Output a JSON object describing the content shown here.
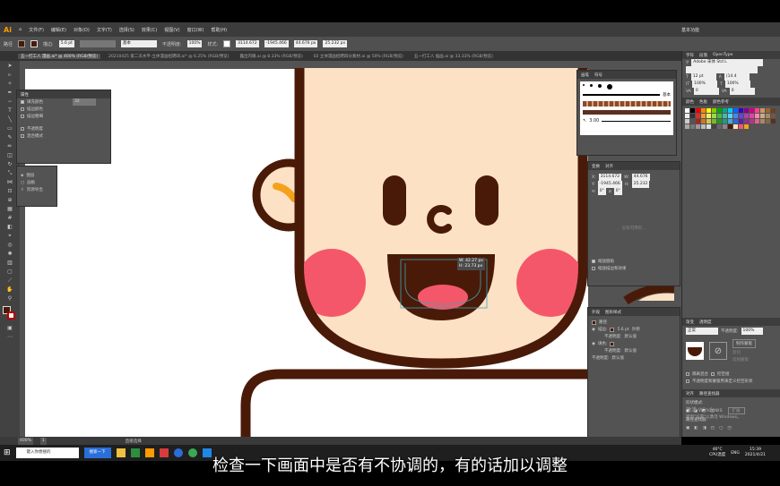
{
  "menubar": {
    "logo": "Ai",
    "items": [
      "文件(F)",
      "编辑(E)",
      "对象(O)",
      "文字(T)",
      "选择(S)",
      "效果(C)",
      "视图(V)",
      "窗口(W)",
      "帮助(H)"
    ],
    "workspace": "基本功能"
  },
  "control": {
    "label": "路径",
    "stroke_label": "描边:",
    "stroke_value": "5.6 pt",
    "line_label": "基本",
    "opacity_label": "不透明度:",
    "opacity_value": "100%",
    "style_label": "样式:",
    "x_value": "3114.672",
    "y_value": "-1945.466",
    "w_value": "44.676 px",
    "h_value": "25.232 px"
  },
  "tabs": [
    "五一打工人 漫画.ai* @ 400% (RGB/预览)",
    "20210425 第二天水平-立体漫画招聘四.ai* @ 6.25% (RGB/预览)",
    "露出内眼.ai @ 8.33% (RGB/预览)",
    "02 立体漫画招聘四分素材.ai @ 50% (RGB/预览)",
    "五一打工人 插画.ai @ 33.33% (RGB/预览)"
  ],
  "appearance_panel_left": {
    "title": "属性",
    "rows": [
      "填充颜色",
      "描边颜色",
      "描边粗细",
      "不透明度",
      "混合模式"
    ],
    "value": "32"
  },
  "layers_popup": {
    "items": [
      "图层",
      "画板",
      "资源导出"
    ]
  },
  "brush_panel": {
    "tabs": [
      "画笔",
      "符号"
    ],
    "stroke_size": "3.00",
    "basic": "基本"
  },
  "transform_panel": {
    "tabs": [
      "变换",
      "对齐"
    ],
    "x": "3114.672",
    "y": "-1945.466",
    "w": "44.676",
    "h": "25.232",
    "angle": "0°",
    "shear": "0°",
    "scale_strokes": "缩放圆角",
    "scale_effects": "缩放描边和效果",
    "empty_label": "没有可用的..."
  },
  "appearance_panel": {
    "tabs": [
      "外观",
      "图形样式"
    ],
    "title": "路径",
    "stroke_label": "描边:",
    "stroke_value": "5.6 pt",
    "stroke_extra": "外侧",
    "opacity_label": "不透明度:",
    "opacity_value": "默认值",
    "fill_label": "填色:"
  },
  "right_panel": {
    "char_tabs": [
      "字符",
      "段落",
      "OpenType"
    ],
    "font": "Adobe 宋体 Std L",
    "font_size": "12 pt",
    "leading": "(14.4",
    "tracking": "100%",
    "scale": "100%",
    "kerning": "0",
    "color_tabs": [
      "颜色",
      "色板",
      "颜色参考"
    ],
    "transparency_tabs": [
      "渐变",
      "透明度"
    ],
    "blend": "正常",
    "opacity": "100%",
    "make_mask": "制作蒙版",
    "clip": "剪切",
    "invert": "反相蒙版",
    "isolate": "隔离混合",
    "knockout": "挖空组",
    "opacity_mask": "不透明度和蒙版用来定义挖空形状",
    "pathfinder_tabs": [
      "对齐",
      "路径查找器"
    ],
    "shape_modes": "形状模式:",
    "pathfinders": "路径查找器:",
    "expand": "扩展"
  },
  "canvas": {
    "measure_w": "W: 42.27 px",
    "measure_h": "H: 23.73 px",
    "watermark_line1": "激活 Windows",
    "watermark_line2": "转到\"设置\"以激活 Windows。"
  },
  "status": {
    "zoom": "400%",
    "page": "1",
    "tool": "直接选择"
  },
  "taskbar": {
    "search_placeholder": "键入你想搜的",
    "search_button": "搜索一下",
    "weather": "46°C",
    "weather_sub": "CPU温度",
    "lang": "ENG",
    "time": "15:39",
    "date": "2021/4/21"
  },
  "subtitle": "检查一下画面中是否有不协调的，有的话加以调整",
  "colors": {
    "face": "#fde1c5",
    "outline": "#4a1a08",
    "cheek": "#f5576a",
    "ear_accent": "#f5a21b",
    "tongue": "#f5576a",
    "ui_dark": "#535353"
  }
}
